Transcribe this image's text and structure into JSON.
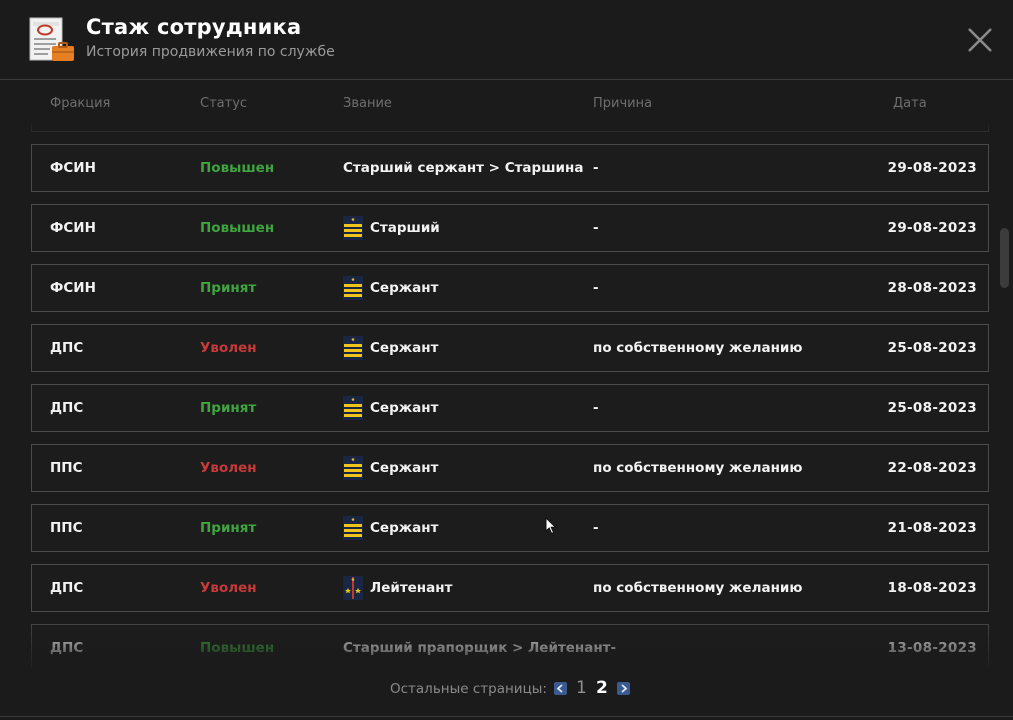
{
  "header": {
    "title": "Стаж сотрудника",
    "subtitle": "История продвижения по службе"
  },
  "columns": {
    "faction": "Фракция",
    "status": "Статус",
    "rank": "Звание",
    "reason": "Причина",
    "date": "Дата"
  },
  "rows": [
    {
      "faction": "",
      "status": "",
      "status_type": "none",
      "rank": "",
      "rank_icon": "none",
      "reason": "",
      "date": ""
    },
    {
      "faction": "ФСИН",
      "status": "Повышен",
      "status_type": "promoted",
      "rank": "Старший сержант > Старшина",
      "rank_icon": "none",
      "reason": "-",
      "date": "29-08-2023"
    },
    {
      "faction": "ФСИН",
      "status": "Повышен",
      "status_type": "promoted",
      "rank": "Старший",
      "rank_icon": "sergeant-stripes-icon",
      "reason": "-",
      "date": "29-08-2023"
    },
    {
      "faction": "ФСИН",
      "status": "Принят",
      "status_type": "hired",
      "rank": "Сержант",
      "rank_icon": "sergeant-stripes-icon",
      "reason": "-",
      "date": "28-08-2023"
    },
    {
      "faction": "ДПС",
      "status": "Уволен",
      "status_type": "fired",
      "rank": "Сержант",
      "rank_icon": "sergeant-stripes-icon",
      "reason": "по собственному желанию",
      "date": "25-08-2023"
    },
    {
      "faction": "ДПС",
      "status": "Принят",
      "status_type": "hired",
      "rank": "Сержант",
      "rank_icon": "sergeant-stripes-icon",
      "reason": "-",
      "date": "25-08-2023"
    },
    {
      "faction": "ППС",
      "status": "Уволен",
      "status_type": "fired",
      "rank": "Сержант",
      "rank_icon": "sergeant-stripes-icon",
      "reason": "по собственному желанию",
      "date": "22-08-2023"
    },
    {
      "faction": "ППС",
      "status": "Принят",
      "status_type": "hired",
      "rank": "Сержант",
      "rank_icon": "sergeant-stripes-icon",
      "reason": "-",
      "date": "21-08-2023"
    },
    {
      "faction": "ДПС",
      "status": "Уволен",
      "status_type": "fired",
      "rank": "Лейтенант",
      "rank_icon": "lieutenant-stars-icon",
      "reason": "по собственному желанию",
      "date": "18-08-2023"
    },
    {
      "faction": "ДПС",
      "status": "Повышен",
      "status_type": "promoted",
      "rank": "Старший прапорщик > Лейтенант-",
      "rank_icon": "none",
      "reason": "",
      "date": "13-08-2023"
    }
  ],
  "pager": {
    "label": "Остальные страницы:",
    "pages": [
      "1",
      "2"
    ],
    "current": "2"
  },
  "colors": {
    "promoted": "#3fa43f",
    "hired": "#3fa43f",
    "fired": "#c63a3a",
    "background": "#1b1b1b"
  }
}
